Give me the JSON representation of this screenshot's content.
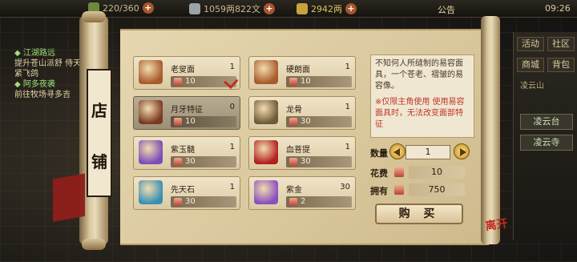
{
  "topbar": {
    "stamina": "220/360",
    "coins": "1059两822文",
    "ingots": "2942两",
    "notice": "公告",
    "time": "09:26"
  },
  "quests": [
    {
      "title": "◆ 江湖路远",
      "desc": "提升苍山派舒 侍天至紧飞鸽"
    },
    {
      "title": "◆ 阿多夜袭",
      "desc": "前往牧场寻多吉"
    }
  ],
  "side": {
    "buttons": [
      "活动",
      "社区",
      "商城",
      "背包"
    ],
    "place": "凌云山",
    "tags": [
      "凌云台",
      "凌云寺"
    ]
  },
  "shop": {
    "sign": [
      "店",
      "铺"
    ],
    "items": [
      {
        "name": "老叟面",
        "count": "1",
        "price": "10",
        "selected": false,
        "checked": true,
        "icon": "chest-icon",
        "color": "#a85a2a"
      },
      {
        "name": "硬朗面",
        "count": "1",
        "price": "10",
        "selected": false,
        "checked": false,
        "icon": "chest-icon",
        "color": "#a85a2a"
      },
      {
        "name": "月牙特征",
        "count": "0",
        "price": "10",
        "selected": true,
        "checked": false,
        "icon": "chest-icon",
        "color": "#7a3a22"
      },
      {
        "name": "龙骨",
        "count": "1",
        "price": "30",
        "selected": false,
        "checked": false,
        "icon": "dragon-bone-icon",
        "color": "#6e5a3a"
      },
      {
        "name": "紫玉髓",
        "count": "1",
        "price": "30",
        "selected": false,
        "checked": false,
        "icon": "crystal-icon",
        "color": "#7c4db8"
      },
      {
        "name": "血菩提",
        "count": "1",
        "price": "30",
        "selected": false,
        "checked": false,
        "icon": "bodhi-icon",
        "color": "#b2201f"
      },
      {
        "name": "先天石",
        "count": "1",
        "price": "30",
        "selected": false,
        "checked": false,
        "icon": "stone-icon",
        "color": "#3a8fb5"
      },
      {
        "name": "紫金",
        "count": "30",
        "price": "2",
        "selected": false,
        "checked": false,
        "icon": "purple-gold-icon",
        "color": "#8a4fc0"
      }
    ],
    "detail": {
      "desc": "不知何人所缝制的易容面具，一个苍老、褶皱的易容像。",
      "tip": "※仅限主角使用 使用易容面具时，无法改变面部特征"
    },
    "qty_label": "数量",
    "qty": "1",
    "cost_label": "花费",
    "cost": "10",
    "own_label": "拥有",
    "own": "750",
    "buy_label": "购 买",
    "logo": "离开"
  }
}
